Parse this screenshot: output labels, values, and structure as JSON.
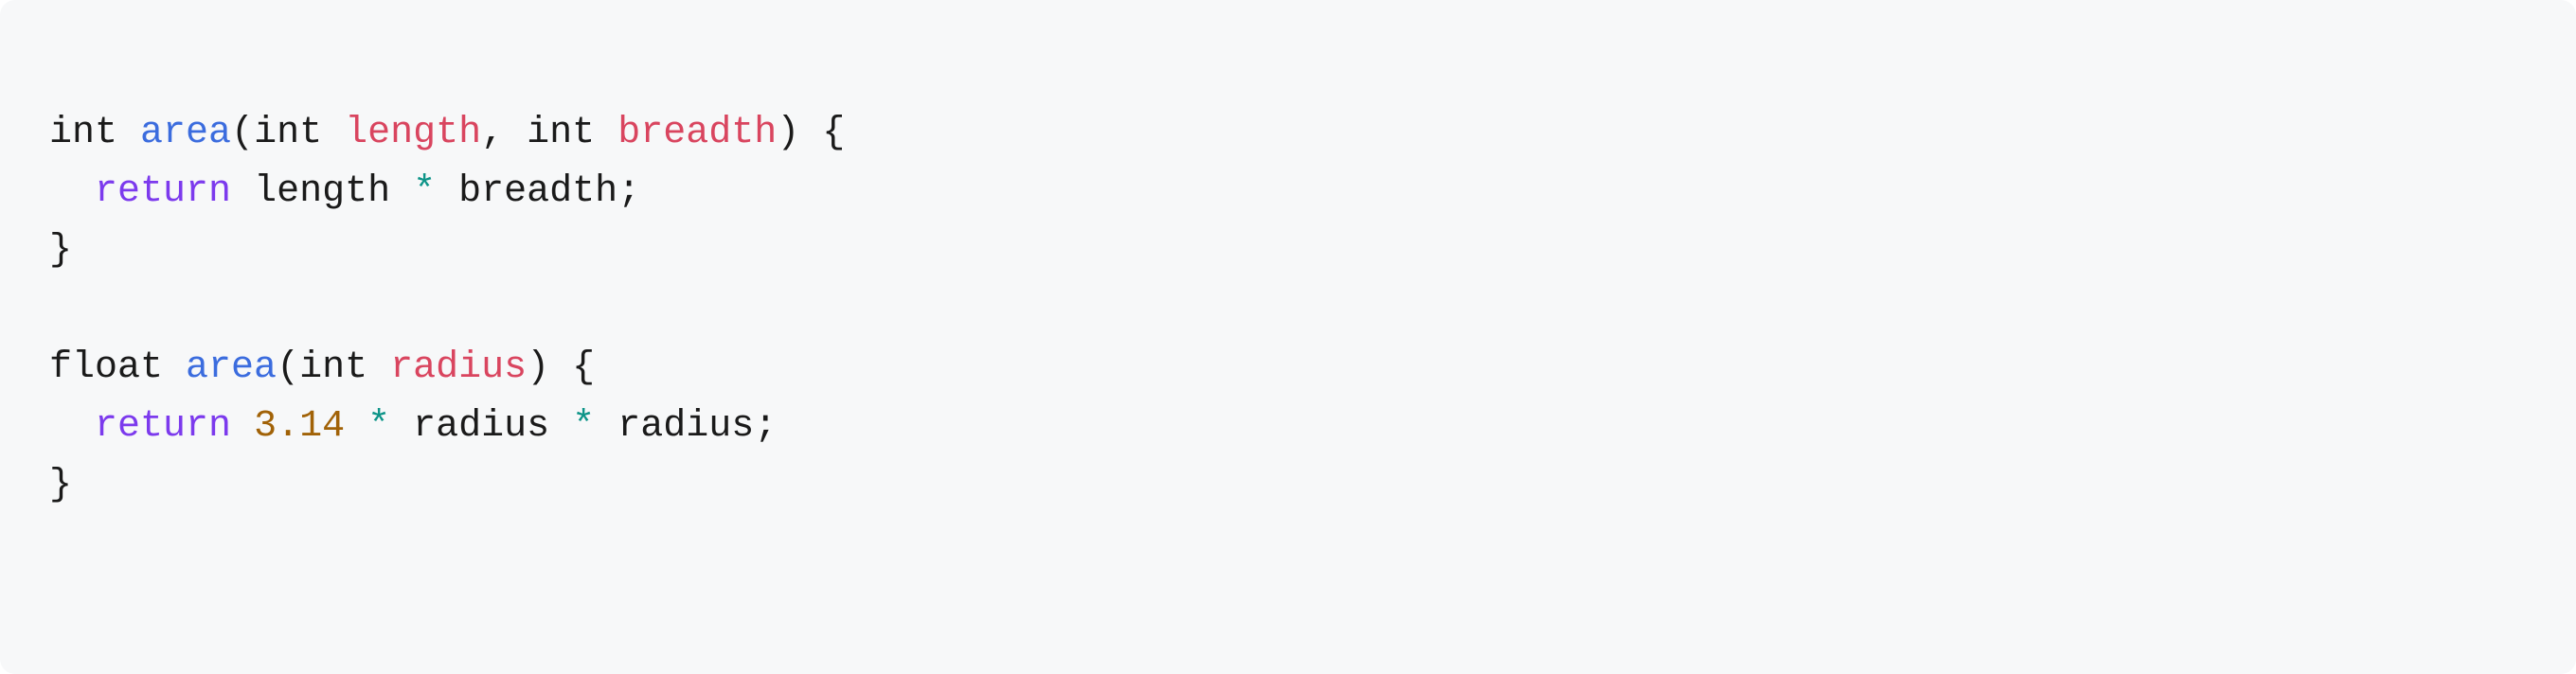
{
  "code": {
    "func1": {
      "ret_type": "int",
      "name": "area",
      "param1_type": "int",
      "param1_name": "length",
      "param2_type": "int",
      "param2_name": "breadth",
      "return_kw": "return",
      "body_ident1": "length",
      "body_op": "*",
      "body_ident2": "breadth"
    },
    "func2": {
      "ret_type": "float",
      "name": "area",
      "param1_type": "int",
      "param1_name": "radius",
      "return_kw": "return",
      "body_number": "3.14",
      "body_op1": "*",
      "body_ident1": "radius",
      "body_op2": "*",
      "body_ident2": "radius"
    },
    "punct": {
      "lparen": "(",
      "rparen": ")",
      "lbrace": "{",
      "rbrace": "}",
      "comma": ",",
      "semicolon": ";",
      "space": " "
    }
  }
}
